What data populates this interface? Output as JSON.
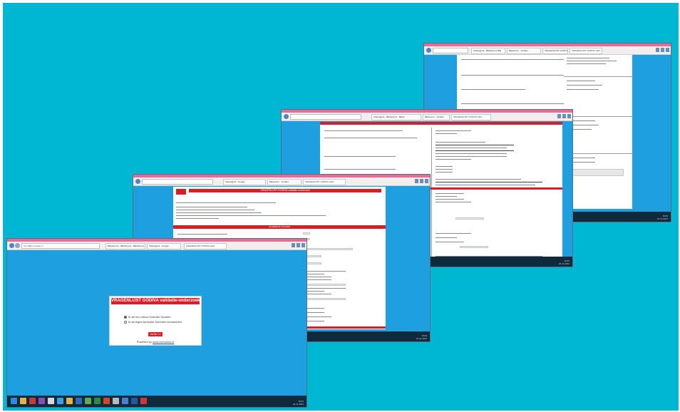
{
  "front_window": {
    "tabs": [
      "Bijbellezers - Bijbellezers - Bijbellezers",
      "Startpagina - Google",
      "Bijbelezen - Vertaler",
      "VRAGENLIJST GODIVA valid..."
    ],
    "address": "Stro Bijbel vertaler.nl",
    "dialog": {
      "title": "VRAGENLIJST GODIVA validatie-onderzoek",
      "option_1": "Ik wil een nieuw formulier invullen",
      "option_2": "Ik wil eigen formulier formulier verzamelen",
      "button": "Verder >>",
      "powered_prefix": "Powered by",
      "powered_link": "www.formdesk.nl"
    },
    "clock_time": "15:01",
    "clock_date": "22-11-2014"
  },
  "window_2": {
    "tabs": [
      "Bijbellezers - Bijbellezers - Bijbellezers",
      "Startpagina - Google",
      "Bijbelezen - Vertaler",
      "VRAGENLIJST GODIVA valid..."
    ],
    "header": "VRAGENLIJST GODIVA validatie-onderzoek",
    "section": "ALGEMENE VRAGEN",
    "clock_time": "15:03",
    "clock_date": "22-11-2014"
  },
  "window_3": {
    "tabs": [
      "Startpagina - Bijbellezers - Bijbel",
      "Bijbelezen - Vertaler",
      "VRAGENLIJST GODIVA valid..."
    ],
    "section": "GEBRUIK BIJBELVERTALINGEN",
    "clock_time": "15:04",
    "clock_date": "22-11-2014"
  },
  "window_4": {
    "tabs": [
      "Startpagina - Bijbellezers Bijb",
      "Bijbelezen - Vertaler",
      "VRAGENLIJST GODIVA valid..."
    ],
    "clock_time": "15:06",
    "clock_date": "22-11-2014"
  },
  "colors": {
    "background": "#00b7d3",
    "window_bg": "#1d9fe0",
    "accent_red": "#dd1c26",
    "tab_pink": "#e86b95",
    "taskbar": "#0f2a3d"
  }
}
